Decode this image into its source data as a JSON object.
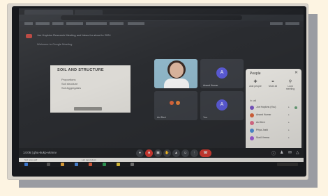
{
  "banner": {
    "line1": "Joe Hopkins Research   Meeting and Ideas for   about to 2024",
    "line2": "Welcome to Google Meeting"
  },
  "presentation": {
    "title": "SOIL AND STRUCTURE",
    "items": [
      "Proportions",
      "Soil structure",
      "Soil Aggregates"
    ]
  },
  "tiles": {
    "cam_label": "",
    "tile2_name": "Anand Kumar",
    "tile3_name": "Avi Devi",
    "tile4_name": "You"
  },
  "people_panel": {
    "title": "People",
    "close": "✕",
    "actions": [
      "Add people",
      "Mute all",
      "Lock meeting"
    ],
    "section": "In call",
    "rows": [
      {
        "name": "Joe Hopkins (You)",
        "color": "#7a55c4"
      },
      {
        "name": "Anand Kumar",
        "color": "#d9643c"
      },
      {
        "name": "Avi Devi",
        "color": "#e06e8b"
      },
      {
        "name": "Priya Joshi",
        "color": "#4f8fd6"
      },
      {
        "name": "Sunil Verma",
        "color": "#9f5cd8"
      }
    ]
  },
  "controls": {
    "time_and_code": "14:06  |  ghu-kukp-vkmnv"
  },
  "downloads": {
    "item1": "Soil notes.pdf",
    "item2": "Lab report.docx"
  },
  "icons": {
    "mic": "mic-icon",
    "cam": "camera-icon",
    "cc": "captions-icon",
    "hand": "raise-hand-icon",
    "present": "present-icon",
    "more": "more-icon",
    "end": "end-call-icon"
  }
}
